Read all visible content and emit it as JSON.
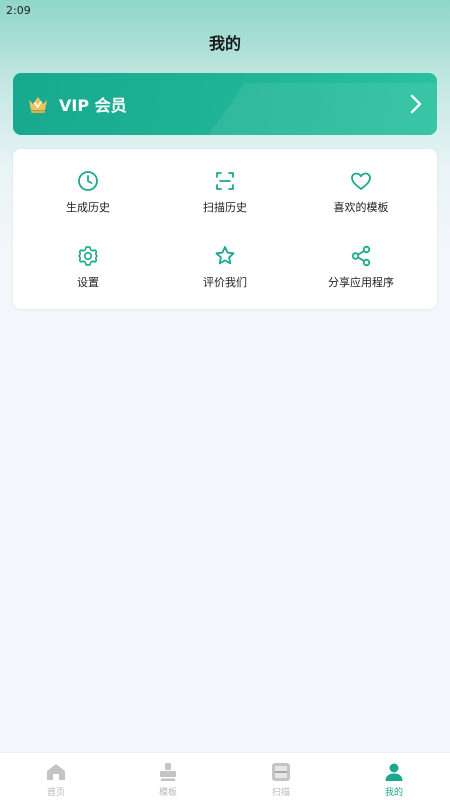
{
  "status_bar": {
    "time": "2:09"
  },
  "header": {
    "title": "我的"
  },
  "vip": {
    "label": "VIP 会员",
    "icon": "crown-icon",
    "arrow_icon": "chevron-right-icon"
  },
  "menu": {
    "items": [
      {
        "label": "生成历史",
        "icon": "clock-icon"
      },
      {
        "label": "扫描历史",
        "icon": "scan-frame-icon"
      },
      {
        "label": "喜欢的模板",
        "icon": "heart-icon"
      },
      {
        "label": "设置",
        "icon": "gear-icon"
      },
      {
        "label": "评价我们",
        "icon": "star-icon"
      },
      {
        "label": "分享应用程序",
        "icon": "share-icon"
      }
    ]
  },
  "tab_bar": {
    "active": "我的",
    "tabs": [
      {
        "label": "首页",
        "icon": "home-icon"
      },
      {
        "label": "模板",
        "icon": "stamp-icon"
      },
      {
        "label": "扫描",
        "icon": "scan-icon"
      },
      {
        "label": "我的",
        "icon": "person-icon"
      }
    ]
  },
  "colors": {
    "accent": "#1aa98d",
    "vip_gradient_start": "#17a98e",
    "vip_gradient_end": "#29c1a0",
    "crown": "#f2c35a"
  }
}
